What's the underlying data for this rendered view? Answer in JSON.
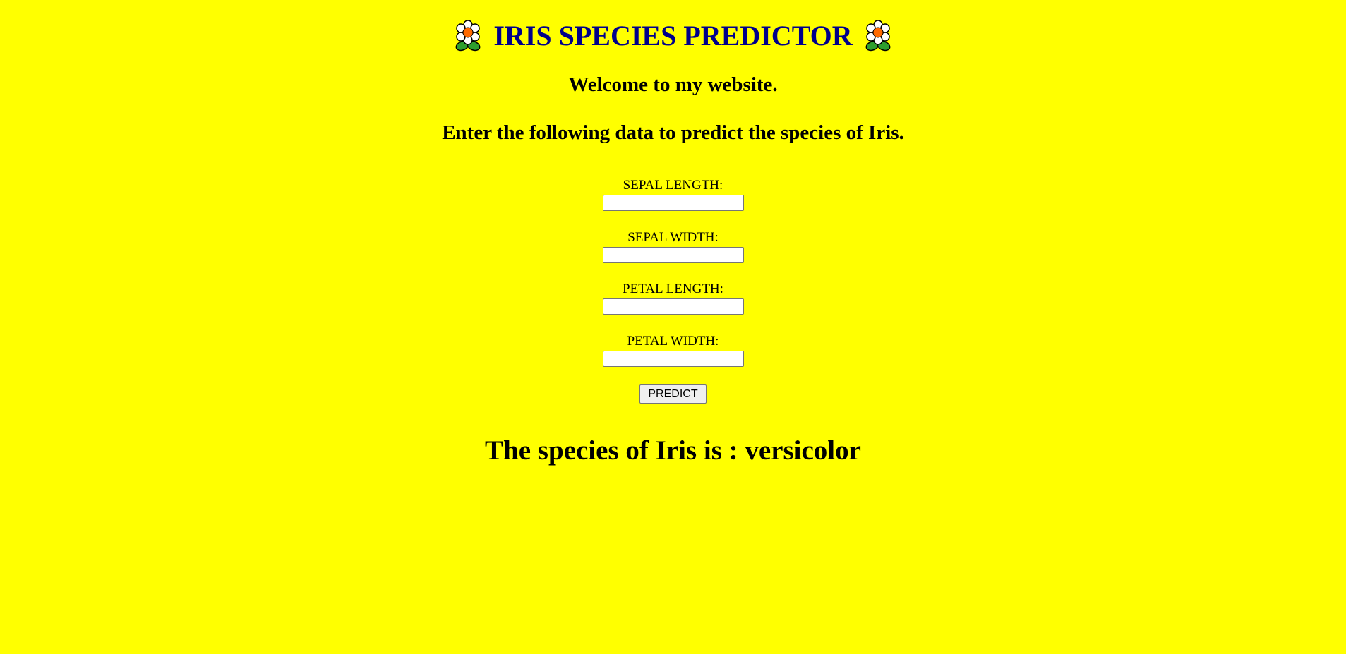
{
  "header": {
    "title": "IRIS SPECIES PREDICTOR",
    "left_icon": "flower-icon",
    "right_icon": "flower-icon",
    "title_color": "#00008b"
  },
  "intro": {
    "welcome": "Welcome to my website.",
    "instructions": "Enter the following data to predict the species of Iris."
  },
  "form": {
    "fields": [
      {
        "label": "SEPAL LENGTH:",
        "value": ""
      },
      {
        "label": "SEPAL WIDTH:",
        "value": ""
      },
      {
        "label": "PETAL LENGTH:",
        "value": ""
      },
      {
        "label": "PETAL WIDTH:",
        "value": ""
      }
    ],
    "submit_label": "PREDICT"
  },
  "result": {
    "text": "The species of Iris is : versicolor"
  },
  "colors": {
    "background": "#ffff00",
    "title": "#00008b"
  }
}
